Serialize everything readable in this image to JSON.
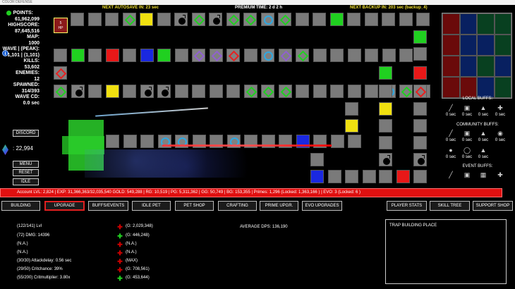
{
  "window": {
    "title": "COLOR DEFENSE"
  },
  "hud": {
    "autosave": "NEXT AUTOSAVE IN: 23 sec",
    "premium": "PREMIUM TIME: 2 d 2 h",
    "backup": "NEXT BACKUP IN: 203 sec (backup_4)"
  },
  "stats": [
    {
      "label": "POINTS:",
      "value": "61,962,099"
    },
    {
      "label": "HIGHSCORE:",
      "value": "87,645,516"
    },
    {
      "label": "MAP:",
      "value": "1000"
    },
    {
      "label": "WAVE | (PEAK):",
      "value": "1,101 | (1,101)"
    },
    {
      "label": "KILLS:",
      "value": "53,602"
    },
    {
      "label": "ENEMIES:",
      "value": "12"
    },
    {
      "label": "SPAWNED:",
      "value": "314/393"
    },
    {
      "label": "WAVE CD:",
      "value": "0.0 sec"
    }
  ],
  "side": {
    "discord": "DISCORD",
    "gems": ": 22,994",
    "menu": "MENU",
    "reset": "RESET",
    "idle": "IDLE"
  },
  "start_tile": {
    "line1": "5",
    "line2": "HP"
  },
  "buffs": {
    "local_title": "LOCAL BUFFS:",
    "community_title": "COMMUNITY BUFFS:",
    "event_title": "EVENT BUFFS:",
    "local": [
      "0 sec",
      "0 sec",
      "0 sec",
      "0 sec"
    ],
    "community_row1": [
      "0 sec",
      "0 sec",
      "0 sec",
      "0 sec"
    ],
    "community_row2": [
      "0 sec",
      "0 sec",
      "0 sec"
    ]
  },
  "status_bar": "Account LVL: 2,824 | EXP: 31,366,363/32,035,540   GOLD: 549,288 | RG: 10,519 | PG: 5,311,362 | GG: 50,749 | BG: 153,355 | Primes: 1,296 (Locked: 1,363,166 ) | EVO: 3 (Locked: 6 )",
  "tabs": [
    "BUILDING",
    "UPGRADE",
    "BUFFS/EVENTS",
    "IDLE PET",
    "PET SHOP",
    "CRAFTING",
    "PRIME UPGR.",
    "EVO UPGRADES",
    "PLAYER STATS",
    "SKILL TREE",
    "SUPPORT SHOP"
  ],
  "upgrades": [
    {
      "stat": "(122/141) Lvl",
      "cost": "(G: 2,029,348)"
    },
    {
      "stat": "(72) DMG: 14396",
      "cost": "(G: 446,248)"
    },
    {
      "stat": "(N.A.)",
      "cost": "(N.A.)"
    },
    {
      "stat": "(N.A.)",
      "cost": "(N.A.)"
    },
    {
      "stat": "(30/30) Attackdelay: 0.56 sec",
      "cost": "(MAX)"
    },
    {
      "stat": "(29/50) Critchance: 39%",
      "cost": "(G: 708,561)"
    },
    {
      "stat": "(55/200) Critmultiplier: 3.80x",
      "cost": "(G: 453,644)"
    }
  ],
  "average_dps": "AVERAGE DPS: 136,190",
  "trap_box": "TRAP BUILDING PLACE",
  "colors": {
    "status_red": "#e01010",
    "tile_grey": "#808080",
    "accent_green": "#20d020"
  }
}
